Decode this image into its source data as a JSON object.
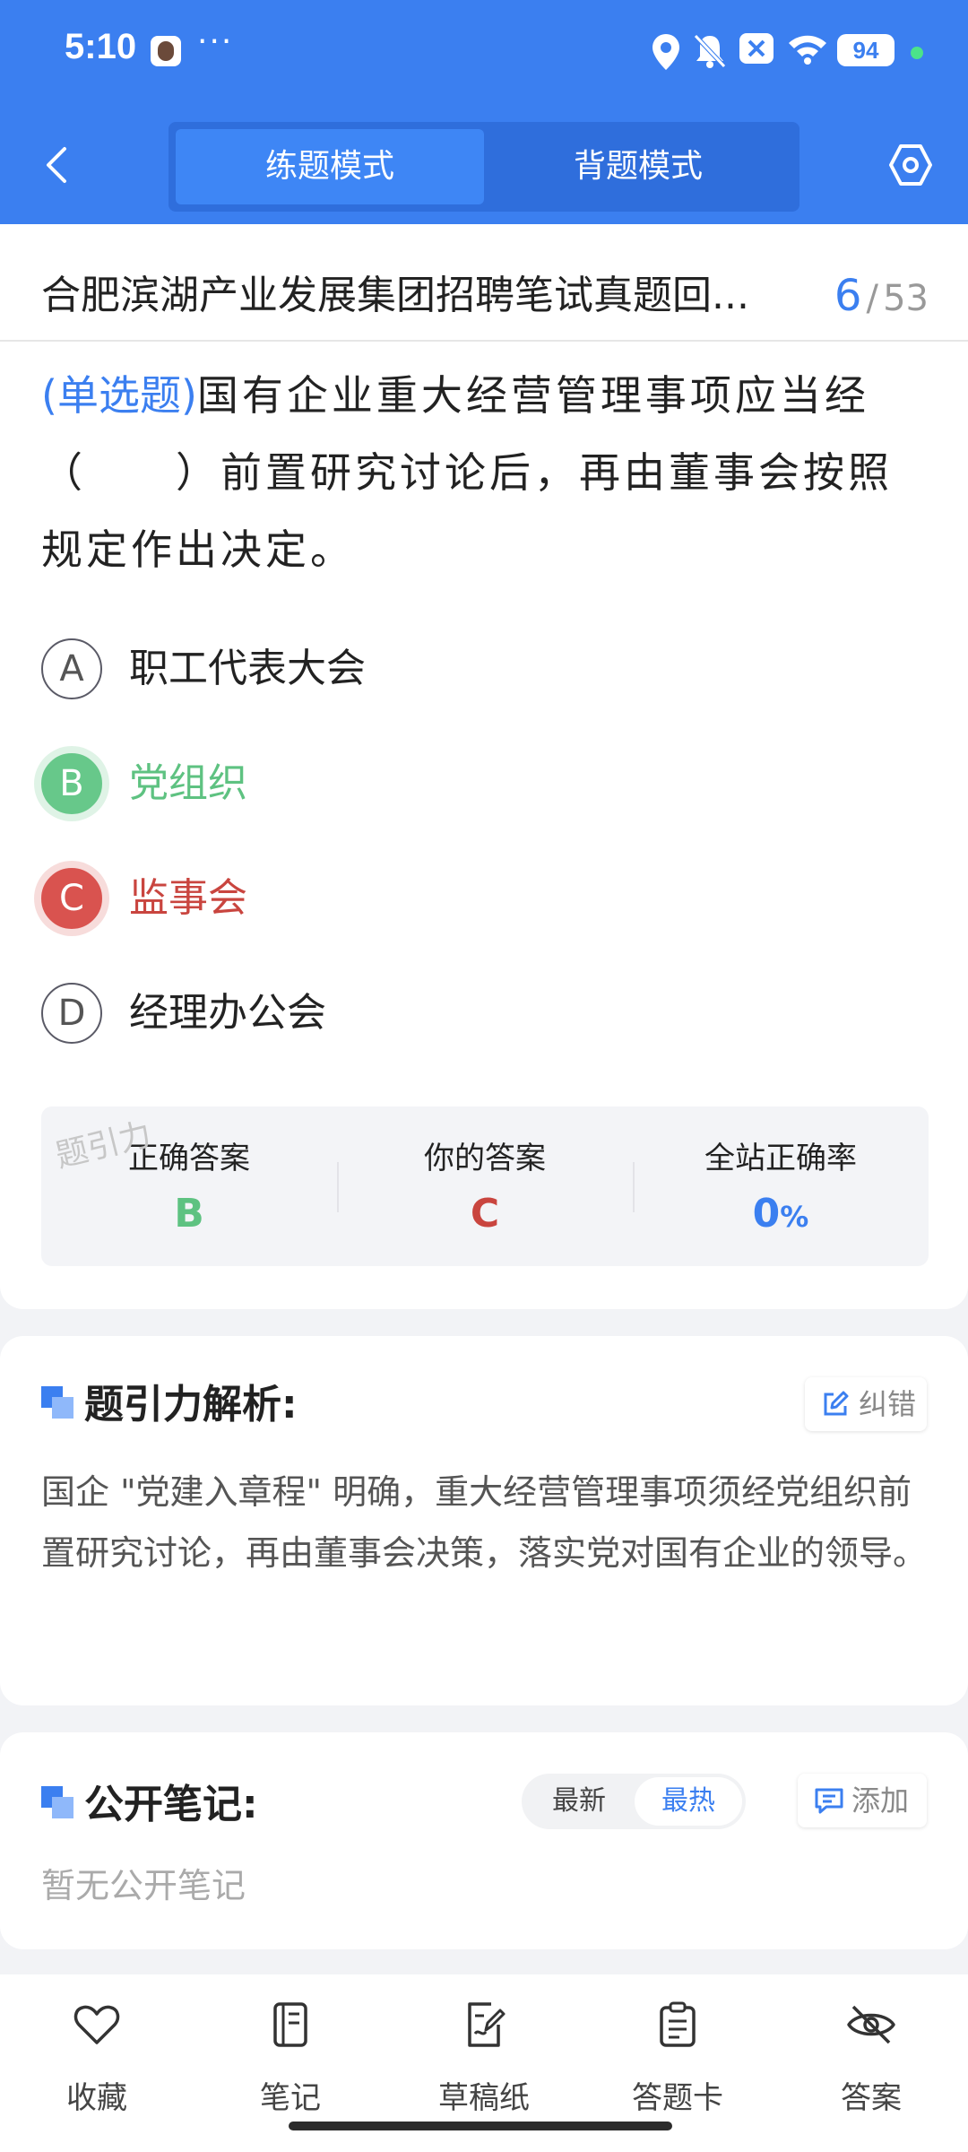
{
  "status_bar": {
    "time": "5:10",
    "more": "···",
    "battery": "94"
  },
  "header": {
    "tabs": [
      {
        "label": "练题模式",
        "active": true
      },
      {
        "label": "背题模式",
        "active": false
      }
    ]
  },
  "paper": {
    "title": "合肥滨湖产业发展集团招聘笔试真题回...",
    "current": "6",
    "separator": "/",
    "total": "53"
  },
  "question": {
    "type": "(单选题)",
    "text": "国有企业重大经营管理事项应当经（　　）前置研究讨论后，再由董事会按照规定作出决定。",
    "options": [
      {
        "letter": "A",
        "text": "职工代表大会",
        "state": "normal"
      },
      {
        "letter": "B",
        "text": "党组织",
        "state": "correct"
      },
      {
        "letter": "C",
        "text": "监事会",
        "state": "wrong"
      },
      {
        "letter": "D",
        "text": "经理办公会",
        "state": "normal"
      }
    ]
  },
  "result": {
    "correct_label": "正确答案",
    "correct_value": "B",
    "yours_label": "你的答案",
    "yours_value": "C",
    "rate_label": "全站正确率",
    "rate_value": "0",
    "rate_unit": "%",
    "watermark": "题引力"
  },
  "analysis": {
    "title": "题引力解析:",
    "report_label": "纠错",
    "text": "国企 \"党建入章程\" 明确，重大经营管理事项须经党组织前置研究讨论，再由董事会决策，落实党对国有企业的领导。"
  },
  "notes": {
    "title": "公开笔记:",
    "sort_latest": "最新",
    "sort_hot": "最热",
    "add_label": "添加",
    "empty_text": "暂无公开笔记"
  },
  "bottom_nav": [
    {
      "label": "收藏",
      "icon": "heart-icon"
    },
    {
      "label": "笔记",
      "icon": "notebook-icon"
    },
    {
      "label": "草稿纸",
      "icon": "draft-icon"
    },
    {
      "label": "答题卡",
      "icon": "clipboard-icon"
    },
    {
      "label": "答案",
      "icon": "eye-off-icon"
    }
  ],
  "colors": {
    "primary": "#3b7ff0",
    "correct": "#67c88a",
    "wrong": "#d9534f"
  }
}
